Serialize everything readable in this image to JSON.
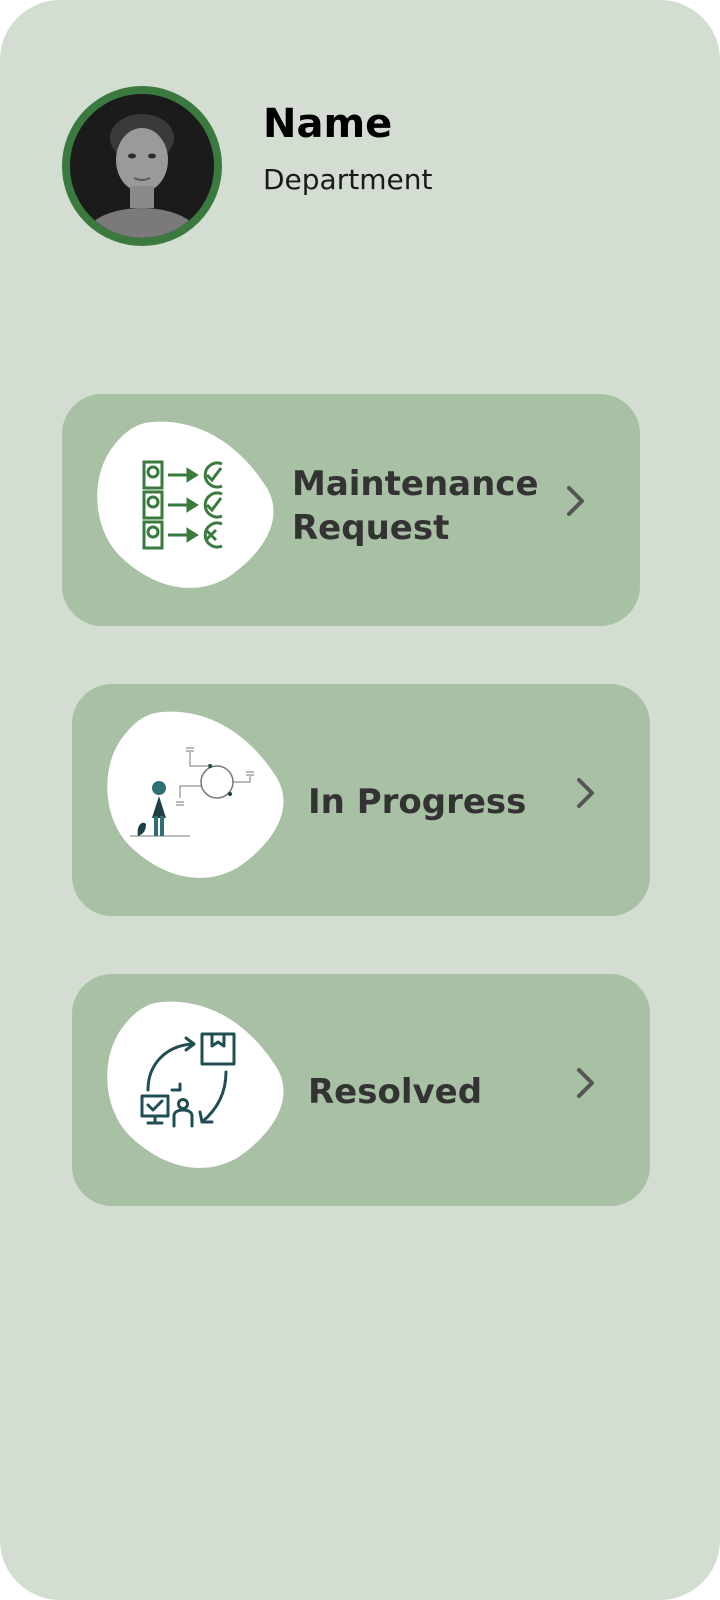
{
  "profile": {
    "name": "Name",
    "department": "Department"
  },
  "cards": [
    {
      "label": "Maintenance Request",
      "icon": "approval-flow-icon"
    },
    {
      "label": "In Progress",
      "icon": "person-process-icon"
    },
    {
      "label": "Resolved",
      "icon": "package-cycle-icon"
    }
  ],
  "colors": {
    "background": "#d3ddd1",
    "card": "#a8c0a3",
    "accent": "#3a7a3f",
    "text": "#333333"
  }
}
